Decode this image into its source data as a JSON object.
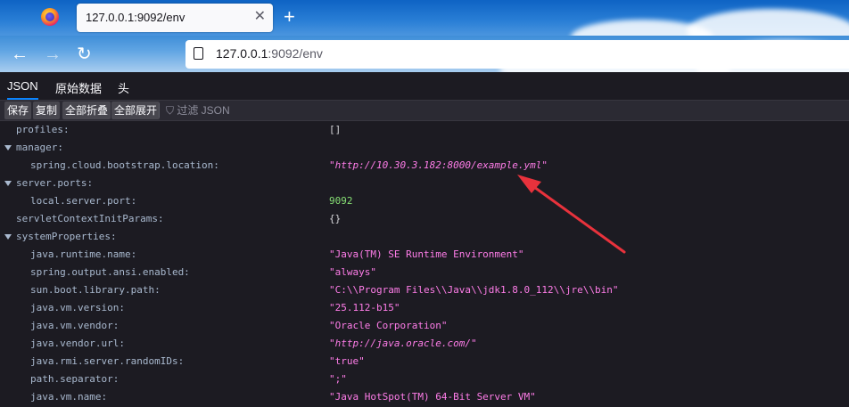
{
  "browser": {
    "tab_title": "127.0.0.1:9092/env",
    "tab_close": "✕",
    "new_tab": "+",
    "url_host": "127.0.0.1",
    "url_rest": ":9092/env",
    "nav": {
      "back": "←",
      "forward": "→",
      "reload": "↻"
    }
  },
  "viewer": {
    "tabs": [
      "JSON",
      "原始数据",
      "头"
    ],
    "toolbar": {
      "save": "保存",
      "copy": "复制",
      "collapse_all": "全部折叠",
      "expand_all": "全部展开",
      "filter_placeholder": "过滤 JSON"
    }
  },
  "json_rows": [
    {
      "key": "profiles:",
      "value": "[]",
      "kind": "plain",
      "indent": 0,
      "toggle": false
    },
    {
      "key": "manager:",
      "value": "",
      "kind": "plain",
      "indent": 0,
      "toggle": true
    },
    {
      "key": "spring.cloud.bootstrap.location:",
      "value": "\"http://10.30.3.182:8000/example.yml\"",
      "kind": "url",
      "indent": 1,
      "toggle": false
    },
    {
      "key": "server.ports:",
      "value": "",
      "kind": "plain",
      "indent": 0,
      "toggle": true
    },
    {
      "key": "local.server.port:",
      "value": "9092",
      "kind": "num",
      "indent": 1,
      "toggle": false
    },
    {
      "key": "servletContextInitParams:",
      "value": "{}",
      "kind": "plain",
      "indent": 0,
      "toggle": false
    },
    {
      "key": "systemProperties:",
      "value": "",
      "kind": "plain",
      "indent": 0,
      "toggle": true
    },
    {
      "key": "java.runtime.name:",
      "value": "\"Java(TM) SE Runtime Environment\"",
      "kind": "str",
      "indent": 1,
      "toggle": false
    },
    {
      "key": "spring.output.ansi.enabled:",
      "value": "\"always\"",
      "kind": "str",
      "indent": 1,
      "toggle": false
    },
    {
      "key": "sun.boot.library.path:",
      "value": "\"C:\\\\Program Files\\\\Java\\\\jdk1.8.0_112\\\\jre\\\\bin\"",
      "kind": "str",
      "indent": 1,
      "toggle": false
    },
    {
      "key": "java.vm.version:",
      "value": "\"25.112-b15\"",
      "kind": "str",
      "indent": 1,
      "toggle": false
    },
    {
      "key": "java.vm.vendor:",
      "value": "\"Oracle Corporation\"",
      "kind": "str",
      "indent": 1,
      "toggle": false
    },
    {
      "key": "java.vendor.url:",
      "value": "\"http://java.oracle.com/\"",
      "kind": "url",
      "indent": 1,
      "toggle": false
    },
    {
      "key": "java.rmi.server.randomIDs:",
      "value": "\"true\"",
      "kind": "str",
      "indent": 1,
      "toggle": false
    },
    {
      "key": "path.separator:",
      "value": "\";\"",
      "kind": "str",
      "indent": 1,
      "toggle": false
    },
    {
      "key": "java.vm.name:",
      "value": "\"Java HotSpot(TM) 64-Bit Server VM\"",
      "kind": "str",
      "indent": 1,
      "toggle": false
    }
  ],
  "colors": {
    "annotation_arrow": "#e8323c",
    "string": "#ff7de9",
    "number": "#86de74",
    "key": "#a9b9cf"
  }
}
